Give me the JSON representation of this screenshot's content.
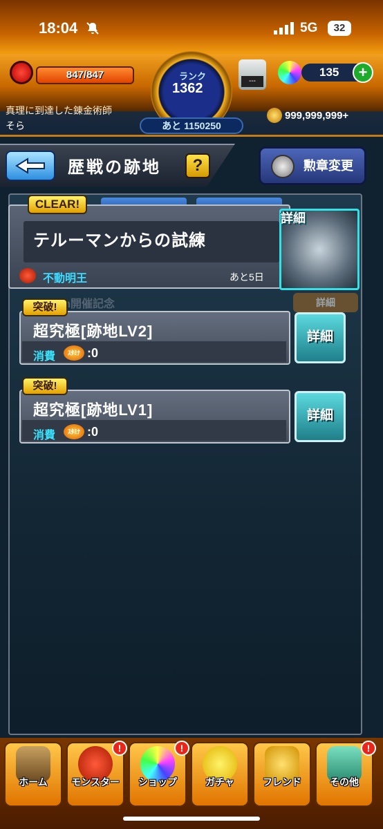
{
  "status": {
    "time": "18:04",
    "network": "5G",
    "battery": "32"
  },
  "header": {
    "stamina": "847/847",
    "rank_label": "ランク",
    "rank": "1362",
    "rank_next": "あと 1150250",
    "item_value": "---",
    "orbs": "135",
    "player_title": "真理に到達した錬金術師",
    "player_name": "そら",
    "gold": "999,999,999+"
  },
  "title_bar": {
    "title": "歴戦の跡地",
    "help": "?",
    "medal_button": "勲章変更"
  },
  "event": {
    "badge": "CLEAR!",
    "title": "テルーマンからの試練",
    "boss": "不動明王",
    "days_left": "あと5日",
    "detail": "詳細"
  },
  "faded": {
    "text": "0th開催記念",
    "button": "詳細"
  },
  "quests": [
    {
      "badge": "突破!",
      "title": "超究極[跡地LV2]",
      "cost_label": "消費",
      "stamina_icon": "ｽﾀﾐﾅ",
      "cost": ":0",
      "detail": "詳細"
    },
    {
      "badge": "突破!",
      "title": "超究極[跡地LV1]",
      "cost_label": "消費",
      "stamina_icon": "ｽﾀﾐﾅ",
      "cost": ":0",
      "detail": "詳細"
    }
  ],
  "nav": [
    {
      "label": "ホーム",
      "alert": ""
    },
    {
      "label": "モンスター",
      "alert": "!"
    },
    {
      "label": "ショップ",
      "alert": "!"
    },
    {
      "label": "ガチャ",
      "alert": ""
    },
    {
      "label": "フレンド",
      "alert": ""
    },
    {
      "label": "その他",
      "alert": "!"
    }
  ]
}
